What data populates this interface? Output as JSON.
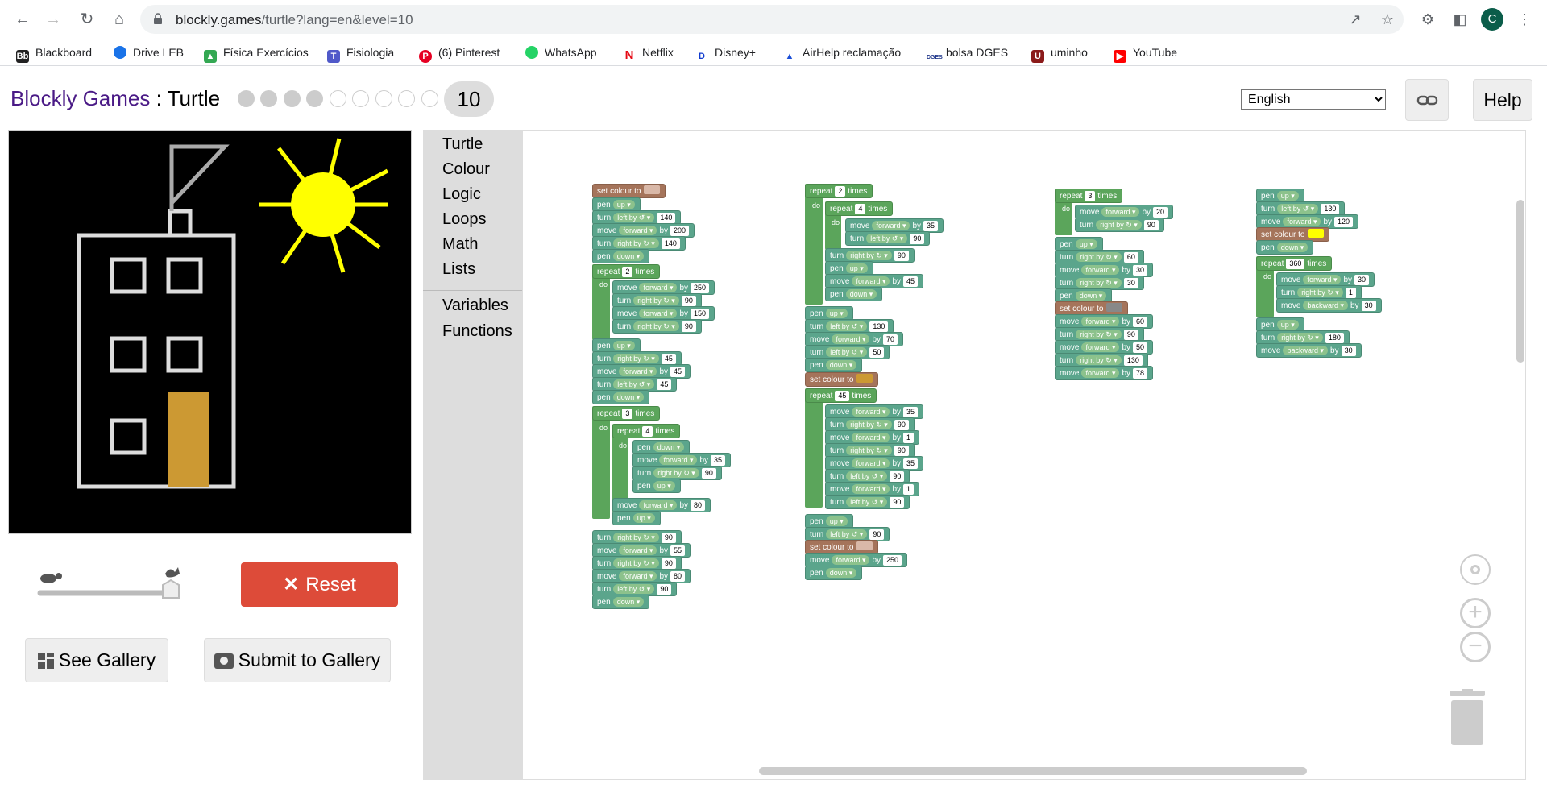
{
  "browser": {
    "url_host": "blockly.games",
    "url_path": "/turtle?lang=en&level=10",
    "avatar_letter": "C",
    "bookmarks": [
      "Blackboard",
      "Drive LEB",
      "Física Exercícios",
      "Fisiologia",
      "(6) Pinterest",
      "WhatsApp",
      "Netflix",
      "Disney+",
      "AirHelp reclamação",
      "bolsa DGES",
      "uminho",
      "YouTube"
    ]
  },
  "app": {
    "brand": "Blockly Games",
    "separator": " : ",
    "game": "Turtle",
    "level": "10",
    "language": "English",
    "help_label": "Help",
    "reset_label": "Reset",
    "gallery_label": "See Gallery",
    "submit_label": "Submit to Gallery"
  },
  "toolbox": [
    "Turtle",
    "Colour",
    "Logic",
    "Loops",
    "Math",
    "Lists",
    "Variables",
    "Functions"
  ],
  "colors": {
    "reset": "#dd4b39",
    "motion": "#5ba58c",
    "loop": "#5ba55b",
    "colour": "#a5745b",
    "door": "#cc9933",
    "sun": "#ffff00"
  },
  "blocks": {
    "col1": [
      {
        "kind": "c",
        "text": "set colour to",
        "swatch": "#d9b8a8"
      },
      {
        "kind": "t",
        "text": "pen",
        "pill": "up"
      },
      {
        "kind": "t",
        "text": "turn",
        "pill": "left by ↺",
        "num": "140"
      },
      {
        "kind": "t",
        "text": "move",
        "pill": "forward",
        "lbl": "by",
        "num": "200"
      },
      {
        "kind": "t",
        "text": "turn",
        "pill": "right by ↻",
        "num": "140"
      },
      {
        "kind": "t",
        "text": "pen",
        "pill": "down"
      },
      {
        "kind": "g",
        "text": "repeat",
        "num": "2",
        "lbl": "times"
      },
      {
        "kind": "t",
        "text": "move",
        "pill": "forward",
        "lbl": "by",
        "num": "250"
      },
      {
        "kind": "t",
        "text": "turn",
        "pill": "right by ↻",
        "num": "90"
      },
      {
        "kind": "t",
        "text": "move",
        "pill": "forward",
        "lbl": "by",
        "num": "150"
      },
      {
        "kind": "t",
        "text": "turn",
        "pill": "right by ↻",
        "num": "90"
      },
      {
        "kind": "t",
        "text": "pen",
        "pill": "up"
      },
      {
        "kind": "t",
        "text": "turn",
        "pill": "right by ↻",
        "num": "45"
      },
      {
        "kind": "t",
        "text": "move",
        "pill": "forward",
        "lbl": "by",
        "num": "45"
      },
      {
        "kind": "t",
        "text": "turn",
        "pill": "left by ↺",
        "num": "45"
      },
      {
        "kind": "t",
        "text": "pen",
        "pill": "down"
      },
      {
        "kind": "g",
        "text": "repeat",
        "num": "3",
        "lbl": "times"
      },
      {
        "kind": "g",
        "text": "repeat",
        "num": "4",
        "lbl": "times"
      },
      {
        "kind": "t",
        "text": "pen",
        "pill": "down"
      },
      {
        "kind": "t",
        "text": "move",
        "pill": "forward",
        "lbl": "by",
        "num": "35"
      },
      {
        "kind": "t",
        "text": "turn",
        "pill": "right by ↻",
        "num": "90"
      },
      {
        "kind": "t",
        "text": "pen",
        "pill": "up"
      },
      {
        "kind": "t",
        "text": "move",
        "pill": "forward",
        "lbl": "by",
        "num": "80"
      },
      {
        "kind": "t",
        "text": "pen",
        "pill": "up"
      },
      {
        "kind": "t",
        "text": "turn",
        "pill": "right by ↻",
        "num": "90"
      },
      {
        "kind": "t",
        "text": "move",
        "pill": "forward",
        "lbl": "by",
        "num": "55"
      },
      {
        "kind": "t",
        "text": "turn",
        "pill": "right by ↻",
        "num": "90"
      },
      {
        "kind": "t",
        "text": "move",
        "pill": "forward",
        "lbl": "by",
        "num": "80"
      },
      {
        "kind": "t",
        "text": "turn",
        "pill": "left by ↺",
        "num": "90"
      },
      {
        "kind": "t",
        "text": "pen",
        "pill": "down"
      }
    ],
    "col2": [
      {
        "kind": "g",
        "text": "repeat",
        "num": "2",
        "lbl": "times"
      },
      {
        "kind": "g",
        "text": "repeat",
        "num": "4",
        "lbl": "times"
      },
      {
        "kind": "t",
        "text": "move",
        "pill": "forward",
        "lbl": "by",
        "num": "35"
      },
      {
        "kind": "t",
        "text": "turn",
        "pill": "left by ↺",
        "num": "90"
      },
      {
        "kind": "t",
        "text": "turn",
        "pill": "right by ↻",
        "num": "90"
      },
      {
        "kind": "t",
        "text": "pen",
        "pill": "up"
      },
      {
        "kind": "t",
        "text": "move",
        "pill": "forward",
        "lbl": "by",
        "num": "45"
      },
      {
        "kind": "t",
        "text": "pen",
        "pill": "down"
      },
      {
        "kind": "t",
        "text": "pen",
        "pill": "up"
      },
      {
        "kind": "t",
        "text": "turn",
        "pill": "left by ↺",
        "num": "130"
      },
      {
        "kind": "t",
        "text": "move",
        "pill": "forward",
        "lbl": "by",
        "num": "70"
      },
      {
        "kind": "t",
        "text": "turn",
        "pill": "left by ↺",
        "num": "50"
      },
      {
        "kind": "t",
        "text": "pen",
        "pill": "down"
      },
      {
        "kind": "c",
        "text": "set colour to",
        "swatch": "#cc9933"
      },
      {
        "kind": "g",
        "text": "repeat",
        "num": "45",
        "lbl": "times"
      },
      {
        "kind": "t",
        "text": "move",
        "pill": "forward",
        "lbl": "by",
        "num": "35"
      },
      {
        "kind": "t",
        "text": "turn",
        "pill": "right by ↻",
        "num": "90"
      },
      {
        "kind": "t",
        "text": "move",
        "pill": "forward",
        "lbl": "by",
        "num": "1"
      },
      {
        "kind": "t",
        "text": "turn",
        "pill": "right by ↻",
        "num": "90"
      },
      {
        "kind": "t",
        "text": "move",
        "pill": "forward",
        "lbl": "by",
        "num": "35"
      },
      {
        "kind": "t",
        "text": "turn",
        "pill": "left by ↺",
        "num": "90"
      },
      {
        "kind": "t",
        "text": "move",
        "pill": "forward",
        "lbl": "by",
        "num": "1"
      },
      {
        "kind": "t",
        "text": "turn",
        "pill": "left by ↺",
        "num": "90"
      },
      {
        "kind": "t",
        "text": "pen",
        "pill": "up"
      },
      {
        "kind": "t",
        "text": "turn",
        "pill": "left by ↺",
        "num": "90"
      },
      {
        "kind": "c",
        "text": "set colour to",
        "swatch": "#d9b8a8"
      },
      {
        "kind": "t",
        "text": "move",
        "pill": "forward",
        "lbl": "by",
        "num": "250"
      },
      {
        "kind": "t",
        "text": "pen",
        "pill": "down"
      }
    ],
    "col3": [
      {
        "kind": "g",
        "text": "repeat",
        "num": "3",
        "lbl": "times"
      },
      {
        "kind": "t",
        "text": "move",
        "pill": "forward",
        "lbl": "by",
        "num": "20"
      },
      {
        "kind": "t",
        "text": "turn",
        "pill": "right by ↻",
        "num": "90"
      },
      {
        "kind": "t",
        "text": "pen",
        "pill": "up"
      },
      {
        "kind": "t",
        "text": "turn",
        "pill": "right by ↻",
        "num": "60"
      },
      {
        "kind": "t",
        "text": "move",
        "pill": "forward",
        "lbl": "by",
        "num": "30"
      },
      {
        "kind": "t",
        "text": "turn",
        "pill": "right by ↻",
        "num": "30"
      },
      {
        "kind": "t",
        "text": "pen",
        "pill": "down"
      },
      {
        "kind": "c",
        "text": "set colour to",
        "swatch": "#888888"
      },
      {
        "kind": "t",
        "text": "move",
        "pill": "forward",
        "lbl": "by",
        "num": "60"
      },
      {
        "kind": "t",
        "text": "turn",
        "pill": "right by ↻",
        "num": "90"
      },
      {
        "kind": "t",
        "text": "move",
        "pill": "forward",
        "lbl": "by",
        "num": "50"
      },
      {
        "kind": "t",
        "text": "turn",
        "pill": "right by ↻",
        "num": "130"
      },
      {
        "kind": "t",
        "text": "move",
        "pill": "forward",
        "lbl": "by",
        "num": "78"
      }
    ],
    "col4": [
      {
        "kind": "t",
        "text": "pen",
        "pill": "up"
      },
      {
        "kind": "t",
        "text": "turn",
        "pill": "left by ↺",
        "num": "130"
      },
      {
        "kind": "t",
        "text": "move",
        "pill": "forward",
        "lbl": "by",
        "num": "120"
      },
      {
        "kind": "c",
        "text": "set colour to",
        "swatch": "#ffff00"
      },
      {
        "kind": "t",
        "text": "pen",
        "pill": "down"
      },
      {
        "kind": "g",
        "text": "repeat",
        "num": "360",
        "lbl": "times"
      },
      {
        "kind": "t",
        "text": "move",
        "pill": "forward",
        "lbl": "by",
        "num": "30"
      },
      {
        "kind": "t",
        "text": "turn",
        "pill": "right by ↻",
        "num": "1"
      },
      {
        "kind": "t",
        "text": "move",
        "pill": "backward",
        "lbl": "by",
        "num": "30"
      },
      {
        "kind": "t",
        "text": "pen",
        "pill": "up"
      },
      {
        "kind": "t",
        "text": "turn",
        "pill": "right by ↻",
        "num": "180"
      },
      {
        "kind": "t",
        "text": "move",
        "pill": "backward",
        "lbl": "by",
        "num": "30"
      }
    ],
    "do_label": "do"
  }
}
